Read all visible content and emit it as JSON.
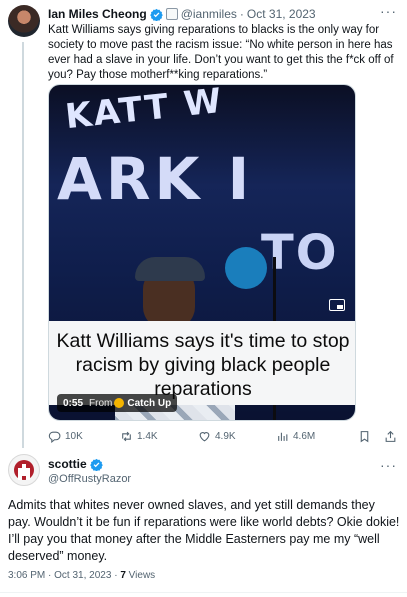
{
  "quoted_tweet": {
    "author_name": "Ian Miles Cheong",
    "handle": "@ianmiles",
    "date": "Oct 31, 2023",
    "text": "Katt Williams says giving reparations to blacks is the only way for society to move past the racism issue: “No white person in here has ever had a slave in your life. Don’t you want to get this the f*ck off of you? Pay those motherf**king reparations.”",
    "media": {
      "banner_text_1": "KATT W",
      "banner_text_2": "ARK I",
      "banner_text_3": "TO",
      "caption": "Katt Williams says it's time to stop racism by giving black people reparations",
      "duration": "0:55",
      "from_label": "From",
      "source_name": "Catch Up"
    },
    "stats": {
      "replies": "10K",
      "reposts": "1.4K",
      "likes": "4.9K",
      "views": "4.6M"
    }
  },
  "reply": {
    "author_name": "scottie",
    "handle": "@OffRustyRazor",
    "text": "Admits that whites never owned slaves, and yet still demands they pay. Wouldn’t it be fun if reparations were like world debts? Okie dokie! I’ll pay you that money after the Middle Easterners pay me my “well deserved” money.",
    "time": "3:06 PM",
    "date": "Oct 31, 2023",
    "separator": "·",
    "views_count": "7",
    "views_label": "Views"
  },
  "colors": {
    "verified_blue": "#1d9bf0",
    "secondary_text": "#536471"
  }
}
